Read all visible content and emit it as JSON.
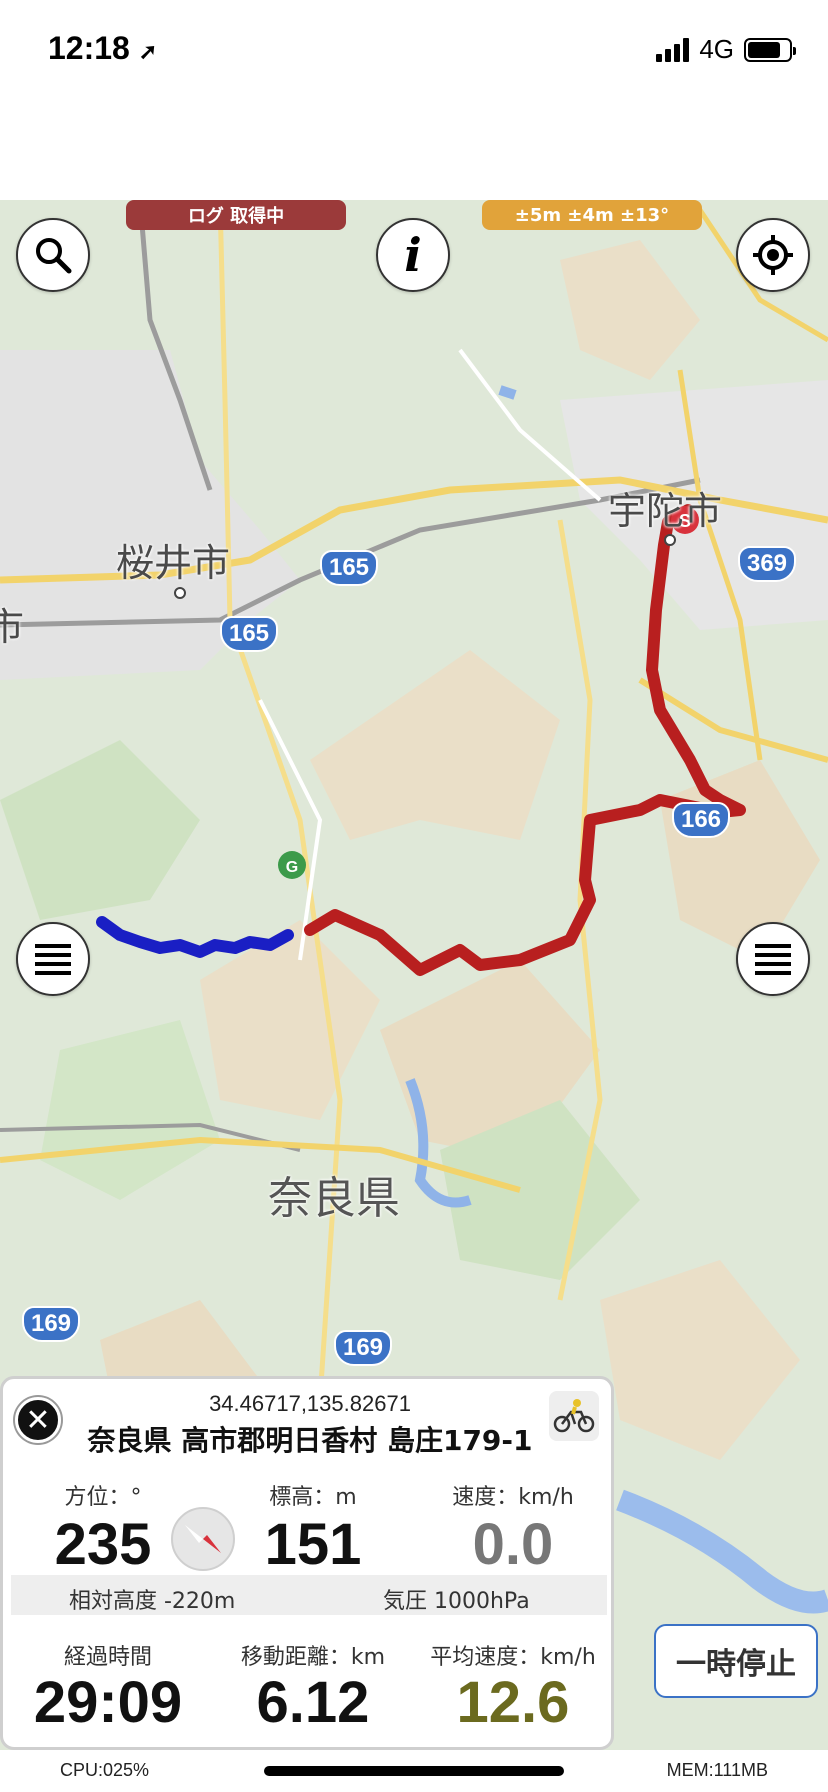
{
  "status_bar": {
    "time": "12:18",
    "network": "4G"
  },
  "top_badges": {
    "log_status": "ログ 取得中",
    "accuracy": "±5m ±4m ±13°"
  },
  "buttons": {
    "info_glyph": "i",
    "pause_label": "一時停止"
  },
  "map": {
    "places": [
      "宇陀市",
      "桜井市",
      "奈良県",
      "市"
    ],
    "routes": [
      "165",
      "165",
      "369",
      "166",
      "169",
      "169"
    ],
    "markers": {
      "start": "S",
      "goal": "G"
    },
    "track_colors": {
      "red": "#b81f1f",
      "blue": "#1a1fc4"
    }
  },
  "panel": {
    "coordinates": "34.46717,135.82671",
    "address": "奈良県 高市郡明日香村 島庄179-1",
    "heading_label": "方位：°",
    "heading_value": "235",
    "altitude_label": "標高：m",
    "altitude_value": "151",
    "speed_label": "速度：km/h",
    "speed_value": "0.0",
    "relative_altitude": "相対高度 -220m",
    "pressure": "気圧 1000hPa",
    "elapsed_label": "経過時間",
    "elapsed_value": "29:09",
    "distance_label": "移動距離：km",
    "distance_value": "6.12",
    "avg_speed_label": "平均速度：km/h",
    "avg_speed_value": "12.6",
    "speed_color": "#777777",
    "avg_speed_color": "#6b6a1f"
  },
  "bottom_bar": {
    "cpu": "CPU:025%",
    "mem": "MEM:111MB"
  }
}
